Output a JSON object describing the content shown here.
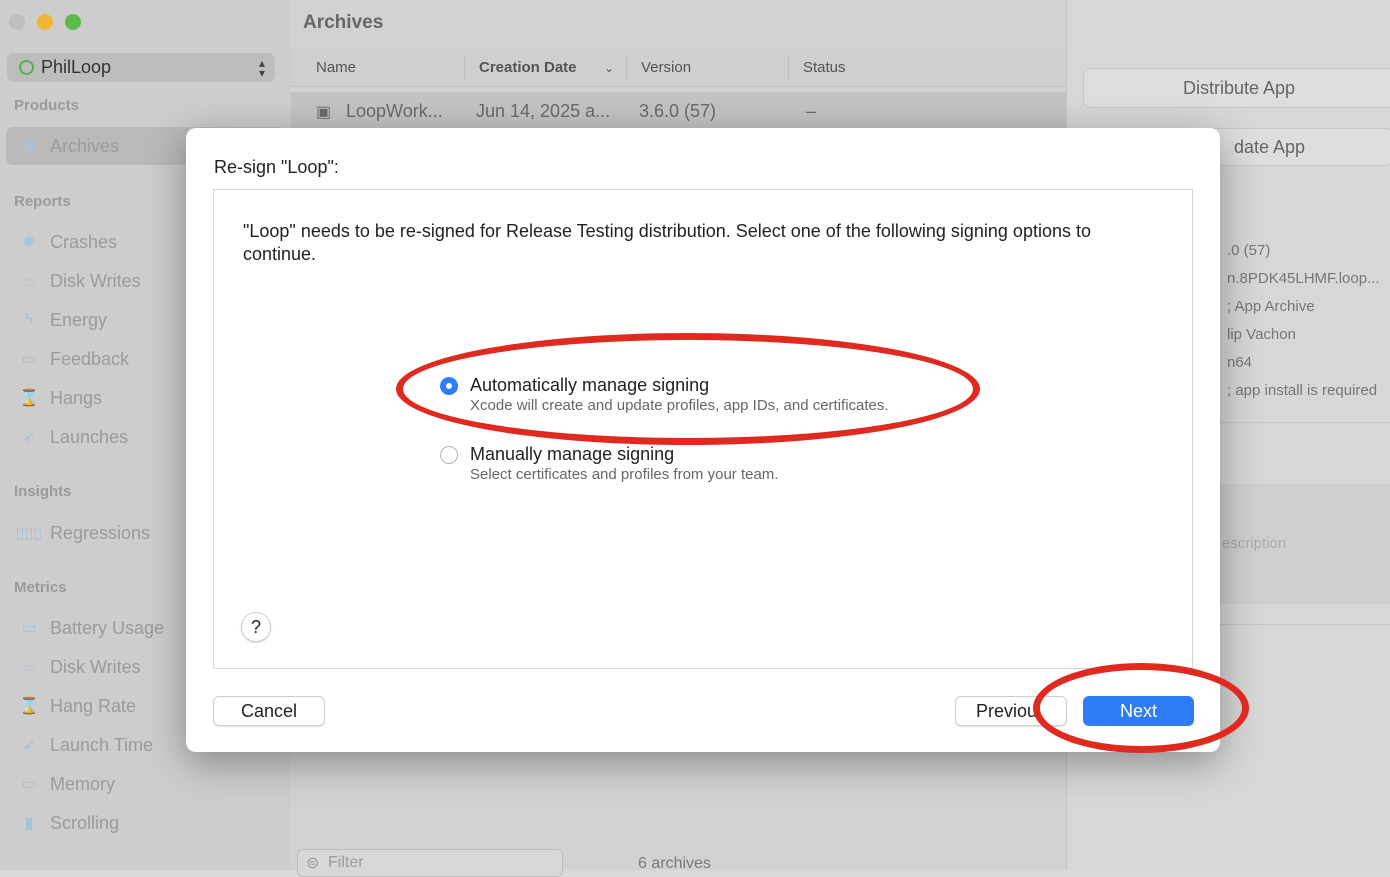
{
  "sidebar": {
    "scheme": "PhilLoop",
    "sections": {
      "products": "Products",
      "reports": "Reports",
      "insights": "Insights",
      "metrics": "Metrics"
    },
    "products_items": [
      "Archives"
    ],
    "reports_items": [
      "Crashes",
      "Disk Writes",
      "Energy",
      "Feedback",
      "Hangs",
      "Launches"
    ],
    "insights_items": [
      "Regressions"
    ],
    "metrics_items": [
      "Battery Usage",
      "Disk Writes",
      "Hang Rate",
      "Launch Time",
      "Memory",
      "Scrolling"
    ]
  },
  "main": {
    "title": "Archives",
    "columns": [
      "Name",
      "Creation Date",
      "Version",
      "Status"
    ],
    "row": {
      "name": "LoopWork...",
      "date": "Jun 14, 2025 a...",
      "version": "3.6.0 (57)",
      "status": "–"
    },
    "filter_placeholder": "Filter",
    "count": "6 archives"
  },
  "right_panel": {
    "distribute_button": "Distribute App",
    "validate_button": "date App",
    "info": [
      ".0 (57)",
      "n.8PDK45LHMF.loop...",
      "; App Archive",
      "lip Vachon",
      "n64",
      "; app install is required"
    ],
    "description_placeholder": "escription"
  },
  "dialog": {
    "title": "Re-sign \"Loop\":",
    "message": "\"Loop\" needs to be re-signed for Release Testing distribution. Select one of the following signing options to continue.",
    "options": [
      {
        "label": "Automatically manage signing",
        "subtitle": "Xcode will create and update profiles, app IDs, and certificates.",
        "selected": true
      },
      {
        "label": "Manually manage signing",
        "subtitle": "Select certificates and profiles from your team.",
        "selected": false
      }
    ],
    "help": "?",
    "cancel": "Cancel",
    "previous": "Previou",
    "next": "Next"
  },
  "colors": {
    "accent": "#2f7df6",
    "annotation": "#e02a20"
  }
}
